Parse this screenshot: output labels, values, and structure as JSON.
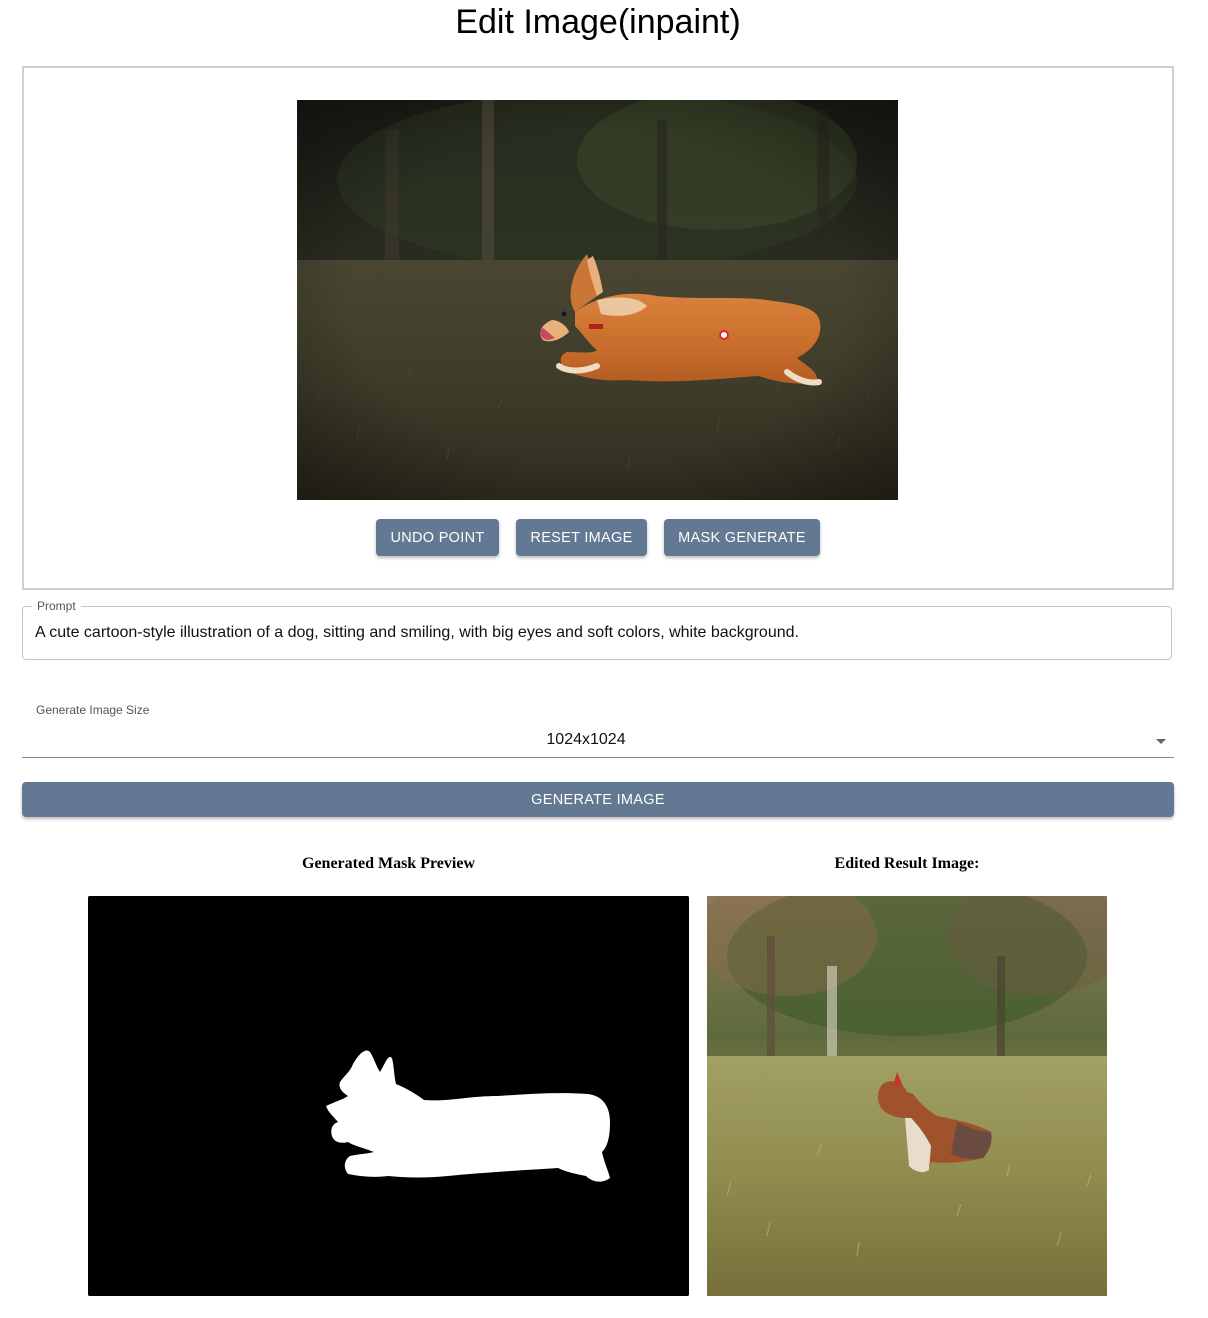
{
  "page": {
    "title": "Edit Image(inpaint)"
  },
  "editor": {
    "buttons": {
      "undo_point": "UNDO POINT",
      "reset_image": "RESET IMAGE",
      "mask_generate": "MASK GENERATE"
    }
  },
  "prompt": {
    "label": "Prompt",
    "value": "A cute cartoon-style illustration of a dog, sitting and smiling, with big eyes and soft colors, white background."
  },
  "size": {
    "label": "Generate Image Size",
    "selected": "1024x1024"
  },
  "generate": {
    "label": "GENERATE IMAGE"
  },
  "mask_preview": {
    "heading": "Generated Mask Preview"
  },
  "result": {
    "heading": "Edited Result Image:"
  },
  "colors": {
    "button": "#627893",
    "point_marker": "#e0242b"
  }
}
